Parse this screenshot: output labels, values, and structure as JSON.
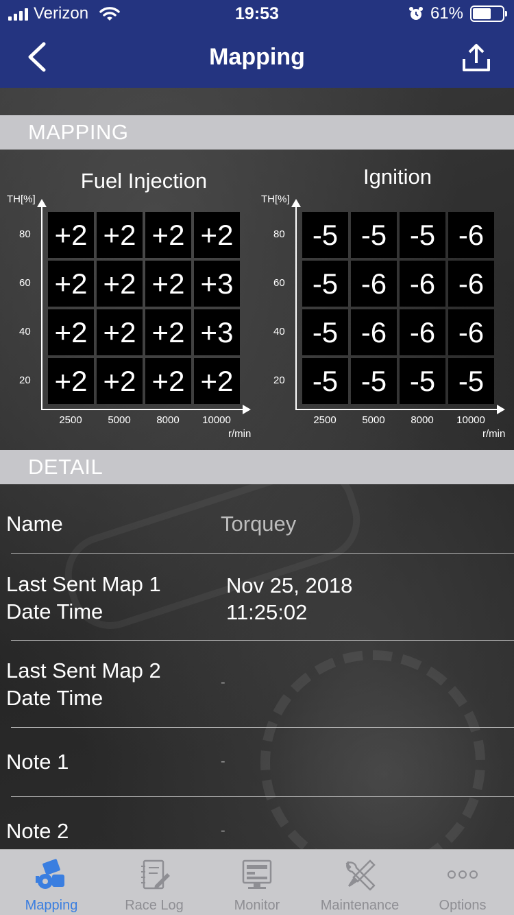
{
  "status_bar": {
    "carrier": "Verizon",
    "time": "19:53",
    "battery": "61%",
    "battery_level": 0.61
  },
  "nav": {
    "title": "Mapping",
    "back_icon": "chevron-left-icon",
    "share_icon": "share-upload-icon"
  },
  "mapping_section": {
    "header": "MAPPING",
    "fuel": {
      "title": "Fuel Injection",
      "y_axis_label": "TH[%]",
      "y_ticks": [
        "80",
        "60",
        "40",
        "20"
      ],
      "x_ticks": [
        "2500",
        "5000",
        "8000",
        "10000"
      ],
      "x_unit": "r/min",
      "grid": [
        [
          "+2",
          "+2",
          "+2",
          "+2"
        ],
        [
          "+2",
          "+2",
          "+2",
          "+3"
        ],
        [
          "+2",
          "+2",
          "+2",
          "+3"
        ],
        [
          "+2",
          "+2",
          "+2",
          "+2"
        ]
      ]
    },
    "ignition": {
      "title": "Ignition",
      "y_axis_label": "TH[%]",
      "y_ticks": [
        "80",
        "60",
        "40",
        "20"
      ],
      "x_ticks": [
        "2500",
        "5000",
        "8000",
        "10000"
      ],
      "x_unit": "r/min",
      "grid": [
        [
          "-5",
          "-5",
          "-5",
          "-6"
        ],
        [
          "-5",
          "-6",
          "-6",
          "-6"
        ],
        [
          "-5",
          "-6",
          "-6",
          "-6"
        ],
        [
          "-5",
          "-5",
          "-5",
          "-5"
        ]
      ]
    }
  },
  "detail_section": {
    "header": "DETAIL",
    "rows": [
      {
        "label": "Name",
        "value": "Torquey"
      },
      {
        "label_line1": "Last Sent Map 1",
        "label_line2": "Date Time",
        "value_line1": "Nov 25, 2018",
        "value_line2": "11:25:02"
      },
      {
        "label_line1": "Last Sent Map 2",
        "label_line2": "Date Time",
        "value": "-"
      },
      {
        "label": "Note 1",
        "value": "-"
      },
      {
        "label": "Note 2",
        "value": "-"
      }
    ]
  },
  "tabbar": {
    "active_color": "#3a7ee0",
    "inactive_color": "#8e8e93",
    "tabs": [
      {
        "label": "Mapping",
        "icon": "engine-icon",
        "active": true
      },
      {
        "label": "Race Log",
        "icon": "notebook-icon",
        "active": false
      },
      {
        "label": "Monitor",
        "icon": "monitor-icon",
        "active": false
      },
      {
        "label": "Maintenance",
        "icon": "wrench-screwdriver-icon",
        "active": false
      },
      {
        "label": "Options",
        "icon": "more-dots-icon",
        "active": false
      }
    ]
  },
  "colors": {
    "nav_bar": "#243480",
    "section_header": "#c6c6ca",
    "cell_bg": "#000000"
  }
}
